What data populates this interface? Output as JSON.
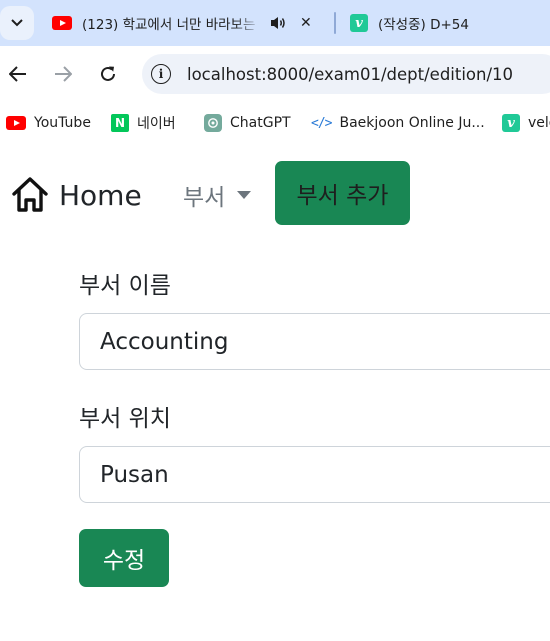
{
  "browser": {
    "tabs": [
      {
        "title": "(123) 학교에서 너만 바라보는",
        "favicon": "youtube-icon",
        "audio": true
      },
      {
        "title": "(작성중) D+54",
        "favicon": "velog-icon",
        "favicon_letter": "v"
      }
    ],
    "url": "localhost:8000/exam01/dept/edition/10",
    "bookmarks": [
      {
        "label": "YouTube",
        "icon": "youtube-icon"
      },
      {
        "label": "네이버",
        "icon": "naver-icon",
        "icon_letter": "N"
      },
      {
        "label": "ChatGPT",
        "icon": "chatgpt-icon"
      },
      {
        "label": "Baekjoon Online Ju...",
        "icon": "code-brackets-icon",
        "icon_text": "</>"
      },
      {
        "label": "velog",
        "icon": "velog-icon",
        "icon_letter": "v"
      }
    ]
  },
  "nav": {
    "home_label": "Home",
    "dept_dropdown_label": "부서",
    "add_dept_label": "부서 추가"
  },
  "form": {
    "name_label": "부서 이름",
    "name_value": "Accounting",
    "location_label": "부서 위치",
    "location_value": "Pusan",
    "submit_label": "수정"
  },
  "colors": {
    "primary_green": "#198754",
    "tabstrip_bg": "#d3e3fd",
    "muted_text": "#6c757d"
  }
}
